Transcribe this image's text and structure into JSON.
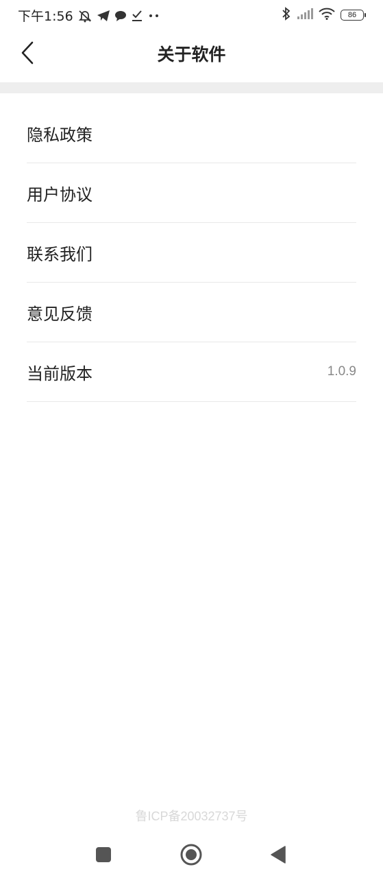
{
  "status_bar": {
    "time": "下午1:56",
    "left_icons": [
      "bell-muted-icon",
      "telegram-icon",
      "chat-bubble-icon",
      "download-check-icon",
      "more-dots-icon"
    ],
    "right_icons": [
      "bluetooth-icon",
      "signal-icon",
      "wifi-icon"
    ],
    "battery_level": "86"
  },
  "header": {
    "title": "关于软件",
    "back_icon": "chevron-left-icon"
  },
  "menu": {
    "items": [
      {
        "label": "隐私政策",
        "value": ""
      },
      {
        "label": "用户协议",
        "value": ""
      },
      {
        "label": "联系我们",
        "value": ""
      },
      {
        "label": "意见反馈",
        "value": ""
      },
      {
        "label": "当前版本",
        "value": "1.0.9"
      }
    ]
  },
  "footer": {
    "icp": "鲁ICP备20032737号"
  },
  "nav_bar": {
    "buttons": [
      "recent-apps-icon",
      "home-icon",
      "back-triangle-icon"
    ]
  },
  "colors": {
    "band": "#eeeeee",
    "divider": "#e8e8e8",
    "value_text": "#888888",
    "icp_text": "#d8d8d8"
  }
}
